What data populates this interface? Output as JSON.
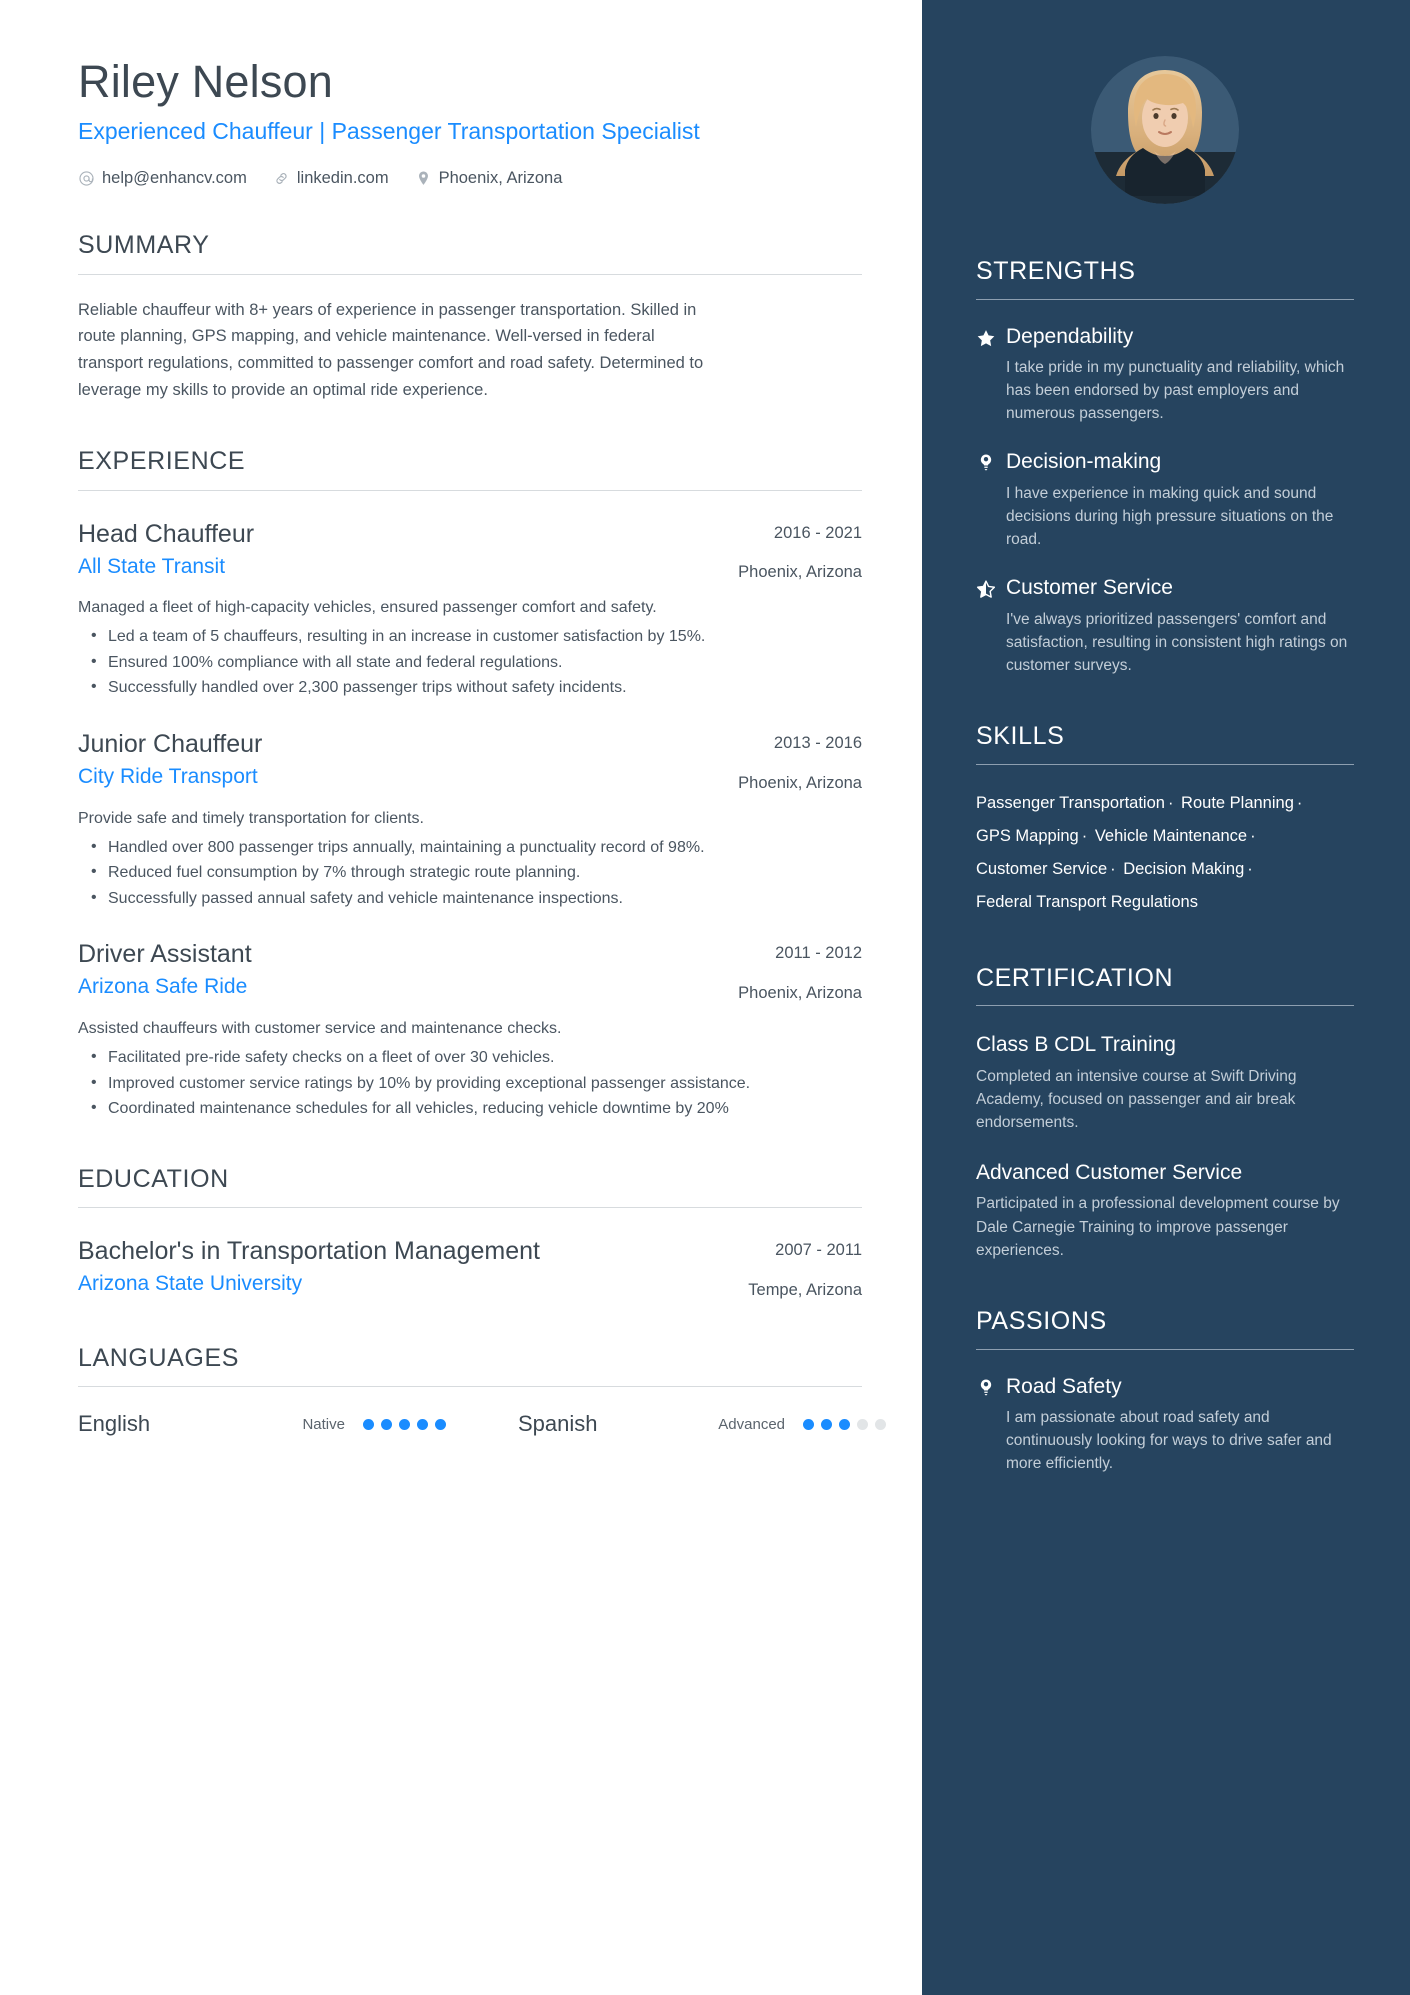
{
  "header": {
    "name": "Riley Nelson",
    "headline": "Experienced Chauffeur | Passenger Transportation Specialist",
    "contacts": [
      {
        "icon": "at-icon",
        "text": "help@enhancv.com"
      },
      {
        "icon": "link-icon",
        "text": "linkedin.com"
      },
      {
        "icon": "location-pin-icon",
        "text": "Phoenix, Arizona"
      }
    ]
  },
  "summary": {
    "title": "SUMMARY",
    "text": "Reliable chauffeur with 8+ years of experience in passenger transportation. Skilled in route planning, GPS mapping, and vehicle maintenance. Well-versed in federal transport regulations, committed to passenger comfort and road safety. Determined to leverage my skills to provide an optimal ride experience."
  },
  "experience": {
    "title": "EXPERIENCE",
    "entries": [
      {
        "role": "Head Chauffeur",
        "org": "All State Transit",
        "dates": "2016 - 2021",
        "location": "Phoenix, Arizona",
        "desc": "Managed a fleet of high-capacity vehicles, ensured passenger comfort and safety.",
        "bullets": [
          "Led a team of 5 chauffeurs, resulting in an increase in customer satisfaction by 15%.",
          "Ensured 100% compliance with all state and federal regulations.",
          "Successfully handled over 2,300 passenger trips without safety incidents."
        ]
      },
      {
        "role": "Junior Chauffeur",
        "org": "City Ride Transport",
        "dates": "2013 - 2016",
        "location": "Phoenix, Arizona",
        "desc": "Provide safe and timely transportation for clients.",
        "bullets": [
          "Handled over 800 passenger trips annually, maintaining a punctuality record of 98%.",
          "Reduced fuel consumption by 7% through strategic route planning.",
          "Successfully passed annual safety and vehicle maintenance inspections."
        ]
      },
      {
        "role": "Driver Assistant",
        "org": "Arizona Safe Ride",
        "dates": "2011 - 2012",
        "location": "Phoenix, Arizona",
        "desc": "Assisted chauffeurs with customer service and maintenance checks.",
        "bullets": [
          "Facilitated pre-ride safety checks on a fleet of over 30 vehicles.",
          "Improved customer service ratings by 10% by providing exceptional passenger assistance.",
          "Coordinated maintenance schedules for all vehicles, reducing vehicle downtime by 20%"
        ]
      }
    ]
  },
  "education": {
    "title": "EDUCATION",
    "entries": [
      {
        "degree": "Bachelor's in Transportation Management",
        "school": "Arizona State University",
        "dates": "2007 - 2011",
        "location": "Tempe, Arizona"
      }
    ]
  },
  "languages": {
    "title": "LANGUAGES",
    "items": [
      {
        "name": "English",
        "level": "Native",
        "filled": 5,
        "total": 5
      },
      {
        "name": "Spanish",
        "level": "Advanced",
        "filled": 3,
        "total": 5
      }
    ]
  },
  "strengths": {
    "title": "STRENGTHS",
    "items": [
      {
        "icon": "star-filled-icon",
        "name": "Dependability",
        "desc": "I take pride in my punctuality and reliability, which has been endorsed by past employers and numerous passengers."
      },
      {
        "icon": "lightbulb-icon",
        "name": "Decision-making",
        "desc": "I have experience in making quick and sound decisions during high pressure situations on the road."
      },
      {
        "icon": "star-half-icon",
        "name": "Customer Service",
        "desc": "I've always prioritized passengers' comfort and satisfaction, resulting in consistent high ratings on customer surveys."
      }
    ]
  },
  "skills": {
    "title": "SKILLS",
    "items": [
      "Passenger Transportation",
      "Route Planning",
      "GPS Mapping",
      "Vehicle Maintenance",
      "Customer Service",
      "Decision Making",
      "Federal Transport Regulations"
    ],
    "separator": "·"
  },
  "certification": {
    "title": "CERTIFICATION",
    "items": [
      {
        "name": "Class B CDL Training",
        "desc": "Completed an intensive course at Swift Driving Academy, focused on passenger and air break endorsements."
      },
      {
        "name": "Advanced Customer Service",
        "desc": "Participated in a professional development course by Dale Carnegie Training to improve passenger experiences."
      }
    ]
  },
  "passions": {
    "title": "PASSIONS",
    "items": [
      {
        "icon": "lightbulb-icon",
        "name": "Road Safety",
        "desc": "I am passionate about road safety and continuously looking for ways to drive safer and more efficiently."
      }
    ]
  },
  "colors": {
    "accent": "#1a8cff",
    "sidebar_bg": "#26445f",
    "text": "#4a5560",
    "heading": "#3d4852"
  }
}
